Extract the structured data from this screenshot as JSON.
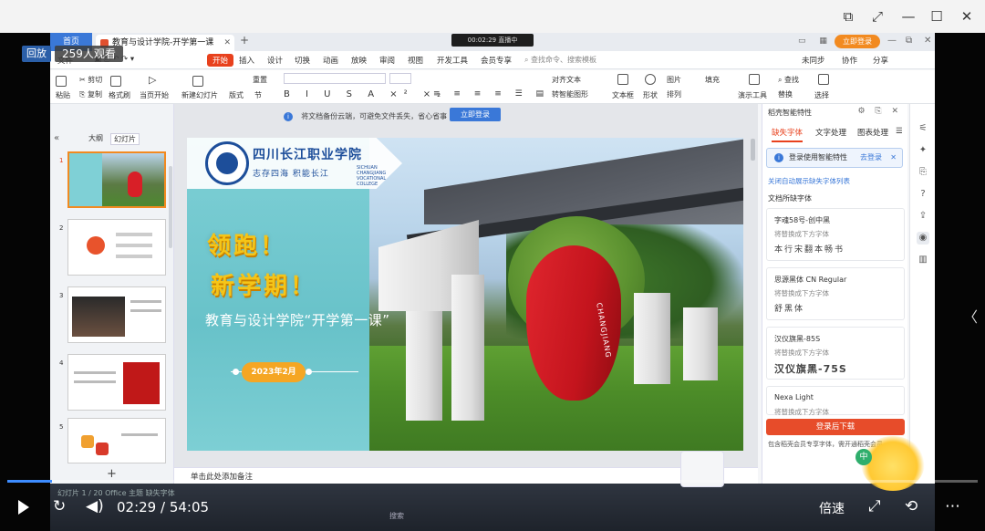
{
  "player": {
    "live_badge": "回放",
    "viewers": "259人观看",
    "time": "02:29 / 54:05",
    "speed_label": "倍速",
    "progress": 0.046
  },
  "app": {
    "home_tab": "首页",
    "doc_tab": "教育与设计学院-开学第一课",
    "live_indicator": "00:02:29  直播中",
    "login_btn": "立即登录",
    "menu": [
      "文件",
      "开始",
      "插入",
      "设计",
      "切换",
      "动画",
      "放映",
      "审阅",
      "视图",
      "开发工具",
      "会员专享"
    ],
    "menu_active": "开始",
    "search": "查找命令、搜索模板",
    "menu_right": [
      "未同步",
      "协作",
      "分享"
    ],
    "ribbon": {
      "paste": "粘贴",
      "cut": "剪切",
      "copy": "复制",
      "format_painter": "格式刷",
      "from_current": "当页开始",
      "new_slide": "新建幻灯片",
      "layout": "版式",
      "section": "节",
      "reset": "重置",
      "text_box": "文本框",
      "shape": "形状",
      "arrange": "排列",
      "picture": "图片",
      "fill": "填充",
      "find": "查找",
      "replace": "替换",
      "select": "选择",
      "present_tools": "演示工具",
      "text_align": "对齐文本",
      "smart_shape": "转智能图形"
    }
  },
  "thumbs": {
    "tab_outline": "大纲",
    "tab_slides": "幻灯片",
    "numbers": [
      "1",
      "2",
      "3",
      "4",
      "5"
    ]
  },
  "canvas": {
    "notice_text": "将文档备份云端，可避免文件丢失，省心省事",
    "notice_btn": "立即登录",
    "notes_placeholder": "单击此处添加备注"
  },
  "slide": {
    "school_name": "四川长江职业学院",
    "motto": "志存四海  积能长江",
    "school_en": "SICHUAN CHANGJIANG VOCATIONAL COLLEGE",
    "headline_1": "领跑！",
    "headline_2": "新学期！",
    "subtitle": "教育与设计学院“开学第一课”",
    "date": "2023年2月",
    "heart_text": "CHANGJIANG"
  },
  "smart_panel": {
    "title": "稻壳智能特性",
    "tabs": [
      "缺失字体",
      "文字处理",
      "图表处理"
    ],
    "login_tip": "登录使用智能特性",
    "login_link": "去登录",
    "auto_link": "关闭自动展示缺失字体列表",
    "section": "文档所缺字体",
    "hint": "将替换成下方字体",
    "fonts": [
      {
        "name": "字魂58号-创中黑",
        "sample": "本行宋翻本畅书"
      },
      {
        "name": "思源黑体 CN Regular",
        "sample": "舒黑体"
      },
      {
        "name": "汉仪旗黑-85S",
        "sample": "汉仪旗黑-75S"
      },
      {
        "name": "Nexa Light",
        "sample": ""
      }
    ],
    "download_btn": "登录后下载",
    "download_note": "包含稻壳会员专享字体，需开通稻壳会员",
    "sticker_label": "中"
  },
  "taskbar": {
    "status": "幻灯片 1 / 20    Office 主题    缺失字体",
    "search": "搜索"
  },
  "colors": {
    "accent_red": "#e8411d",
    "wps_blue": "#3a78d8",
    "slide_teal": "#6ec4cc",
    "headline_yellow": "#f5c518",
    "date_orange": "#f5a623"
  }
}
